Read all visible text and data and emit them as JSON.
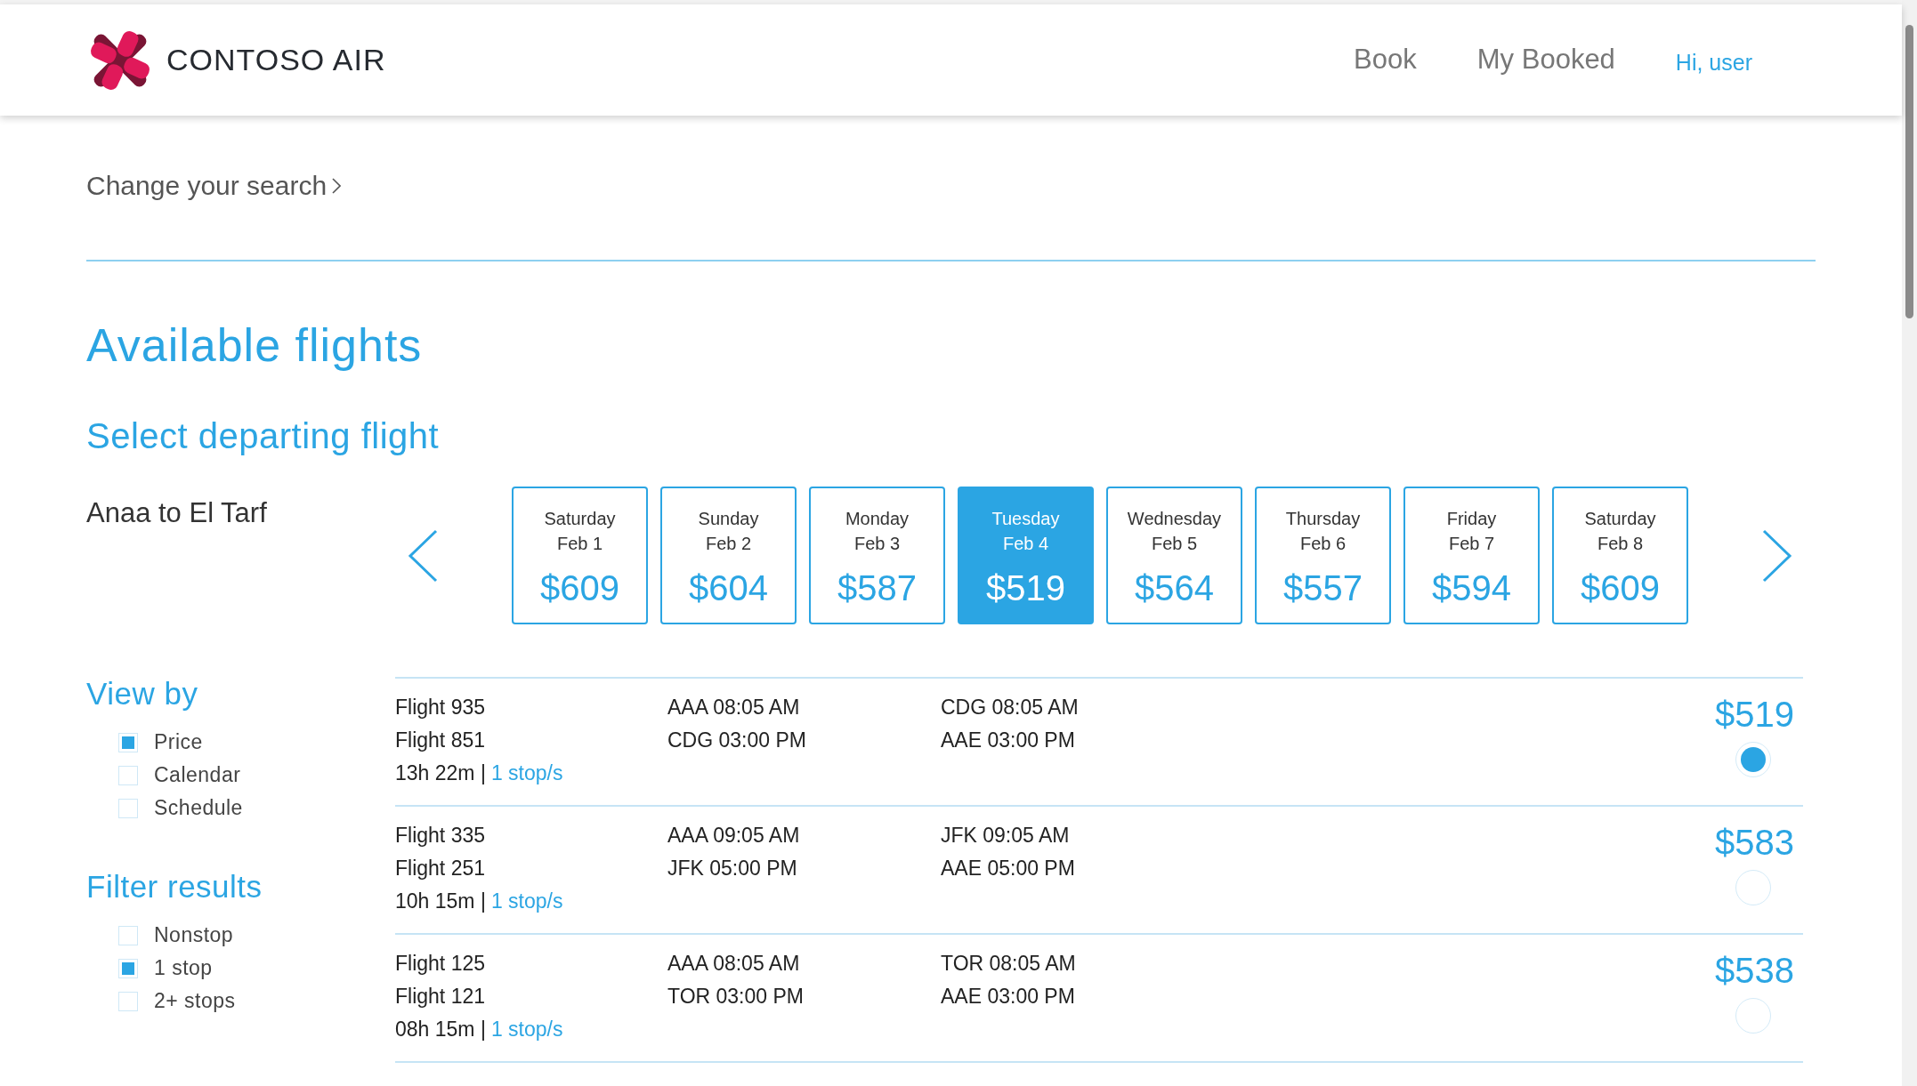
{
  "header": {
    "brand": "CONTOSO AIR",
    "nav": [
      {
        "label": "Book",
        "selected": false
      },
      {
        "label": "My Booked",
        "selected": false
      }
    ],
    "greeting": "Hi, user"
  },
  "search_link": "Change your search",
  "title": "Available flights",
  "subtitle": "Select departing flight",
  "route": "Anaa to El Tarf",
  "dates": [
    {
      "day": "Saturday",
      "date": "Feb 1",
      "price": "$609",
      "selected": false
    },
    {
      "day": "Sunday",
      "date": "Feb 2",
      "price": "$604",
      "selected": false
    },
    {
      "day": "Monday",
      "date": "Feb 3",
      "price": "$587",
      "selected": false
    },
    {
      "day": "Tuesday",
      "date": "Feb 4",
      "price": "$519",
      "selected": true
    },
    {
      "day": "Wednesday",
      "date": "Feb 5",
      "price": "$564",
      "selected": false
    },
    {
      "day": "Thursday",
      "date": "Feb 6",
      "price": "$557",
      "selected": false
    },
    {
      "day": "Friday",
      "date": "Feb 7",
      "price": "$594",
      "selected": false
    },
    {
      "day": "Saturday",
      "date": "Feb 8",
      "price": "$609",
      "selected": false
    }
  ],
  "view_by": {
    "title": "View by",
    "options": [
      {
        "label": "Price",
        "checked": true
      },
      {
        "label": "Calendar",
        "checked": false
      },
      {
        "label": "Schedule",
        "checked": false
      }
    ]
  },
  "filter": {
    "title": "Filter results",
    "options": [
      {
        "label": "Nonstop",
        "checked": false
      },
      {
        "label": "1 stop",
        "checked": true
      },
      {
        "label": "2+ stops",
        "checked": false
      }
    ]
  },
  "flights": [
    {
      "legs": [
        {
          "flight": "Flight 935",
          "depart": "AAA 08:05 AM",
          "arrive": "CDG 08:05 AM"
        },
        {
          "flight": "Flight 851",
          "depart": "CDG 03:00 PM",
          "arrive": "AAE 03:00 PM"
        }
      ],
      "duration": "13h 22m |",
      "stops": "1 stop/s",
      "price": "$519",
      "selected": true
    },
    {
      "legs": [
        {
          "flight": "Flight 335",
          "depart": "AAA 09:05 AM",
          "arrive": "JFK 09:05 AM"
        },
        {
          "flight": "Flight 251",
          "depart": "JFK 05:00 PM",
          "arrive": "AAE 05:00 PM"
        }
      ],
      "duration": "10h 15m |",
      "stops": "1 stop/s",
      "price": "$583",
      "selected": false
    },
    {
      "legs": [
        {
          "flight": "Flight 125",
          "depart": "AAA 08:05 AM",
          "arrive": "TOR 08:05 AM"
        },
        {
          "flight": "Flight 121",
          "depart": "TOR 03:00 PM",
          "arrive": "AAE 03:00 PM"
        }
      ],
      "duration": "08h 15m |",
      "stops": "1 stop/s",
      "price": "$538",
      "selected": false
    }
  ]
}
